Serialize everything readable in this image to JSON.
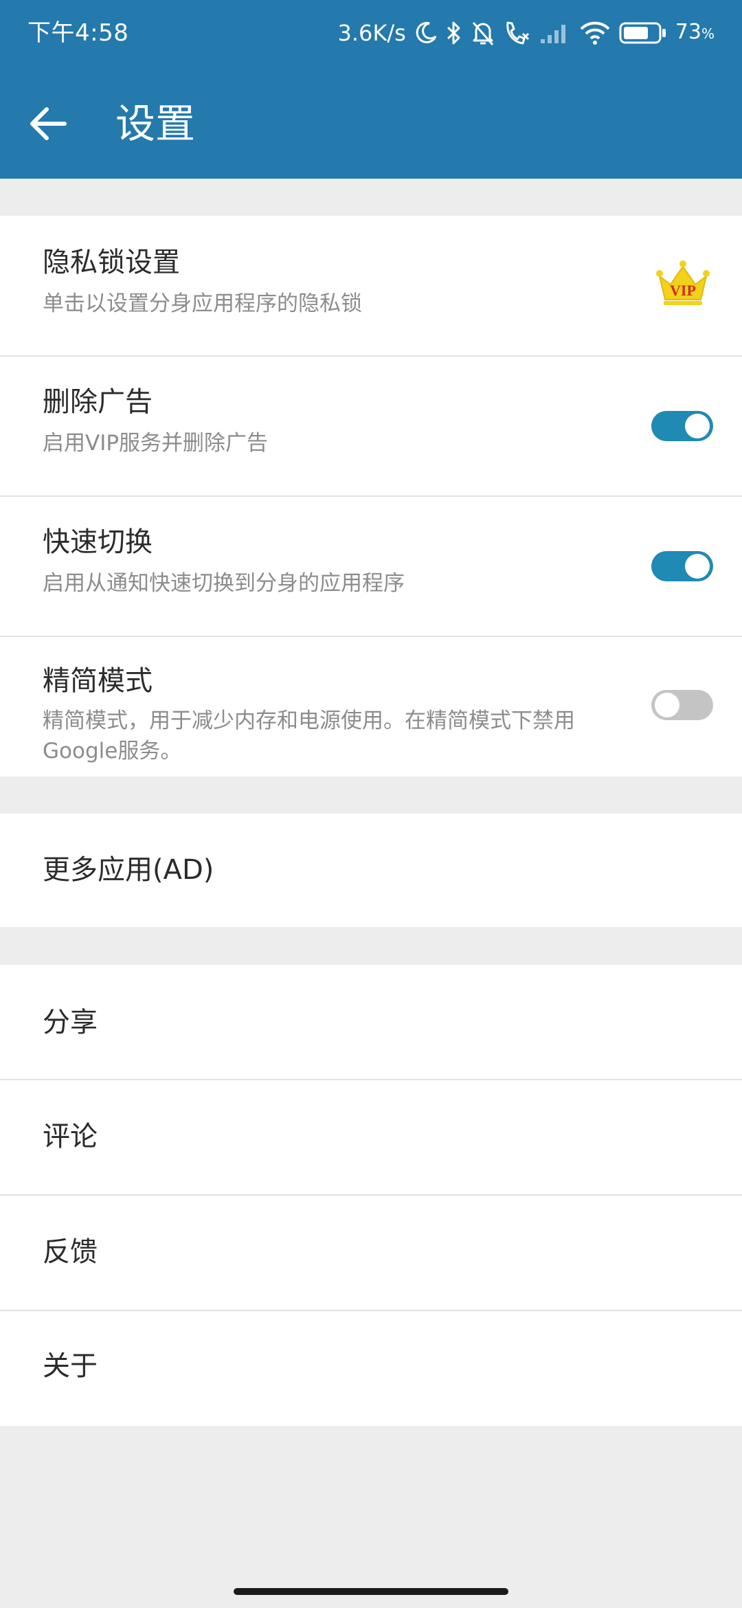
{
  "status_bar": {
    "time": "下午4:58",
    "network_speed": "3.6K/s",
    "battery_percent": "73",
    "battery_unit": "%",
    "battery_level": 0.73,
    "icons": [
      "moon-icon",
      "bluetooth-icon",
      "mute-bell-icon",
      "call-icon",
      "signal-icon",
      "wifi-icon",
      "battery-icon"
    ]
  },
  "toolbar": {
    "title": "设置",
    "back_icon": "arrow-left-icon"
  },
  "colors": {
    "primary": "#2479ad",
    "toggle_on": "#1f8ab4",
    "toggle_off": "#c4c4c4",
    "background": "#ededed",
    "vip_crown": "#f2d21b",
    "vip_text": "#d22a1e"
  },
  "settings": {
    "privacy_lock": {
      "title": "隐私锁设置",
      "subtitle": "单击以设置分身应用程序的隐私锁",
      "badge_text": "VIP",
      "badge_icon": "vip-crown-icon"
    },
    "remove_ads": {
      "title": "删除广告",
      "subtitle": "启用VIP服务并删除广告",
      "enabled": true
    },
    "quick_switch": {
      "title": "快速切换",
      "subtitle": "启用从通知快速切换到分身的应用程序",
      "enabled": true
    },
    "lite_mode": {
      "title": "精简模式",
      "subtitle": "精简模式，用于减少内存和电源使用。在精简模式下禁用Google服务。",
      "enabled": false
    }
  },
  "more_apps": {
    "label": "更多应用(AD)"
  },
  "misc": {
    "share": "分享",
    "review": "评论",
    "feedback": "反馈",
    "about": "关于"
  }
}
